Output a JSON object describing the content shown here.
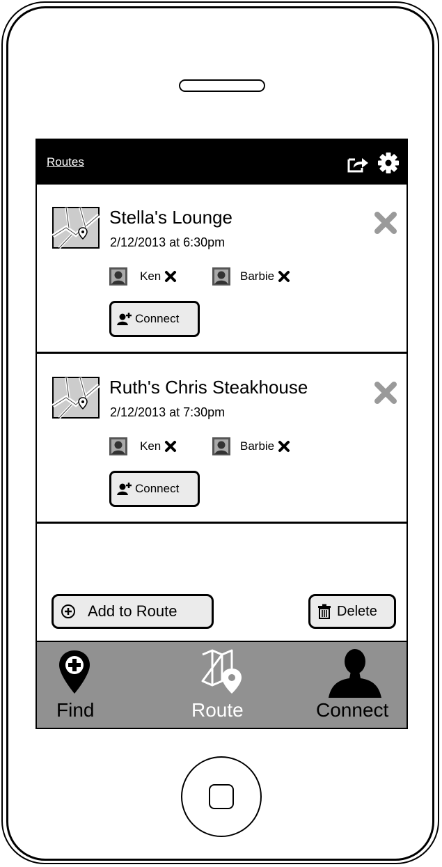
{
  "header": {
    "title": "Routes",
    "share_icon": "share-icon",
    "settings_icon": "gear-icon"
  },
  "routes": [
    {
      "name": "Stella's Lounge",
      "datetime": "2/12/2013 at 6:30pm",
      "attendees": [
        {
          "name": "Ken"
        },
        {
          "name": "Barbie"
        }
      ],
      "connect_label": "Connect"
    },
    {
      "name": "Ruth's Chris Steakhouse",
      "datetime": "2/12/2013 at 7:30pm",
      "attendees": [
        {
          "name": "Ken"
        },
        {
          "name": "Barbie"
        }
      ],
      "connect_label": "Connect"
    }
  ],
  "actions": {
    "add_label": "Add to Route",
    "delete_label": "Delete"
  },
  "tabbar": {
    "tabs": [
      {
        "label": "Find",
        "icon": "find-pin-icon",
        "active": false
      },
      {
        "label": "Route",
        "icon": "route-map-icon",
        "active": true
      },
      {
        "label": "Connect",
        "icon": "person-icon",
        "active": false
      }
    ]
  },
  "colors": {
    "header_bg": "#000000",
    "tabbar_bg": "#919191",
    "button_bg": "#ebebeb",
    "remove_icon": "#9a9a9a",
    "active_tab": "#ffffff"
  }
}
